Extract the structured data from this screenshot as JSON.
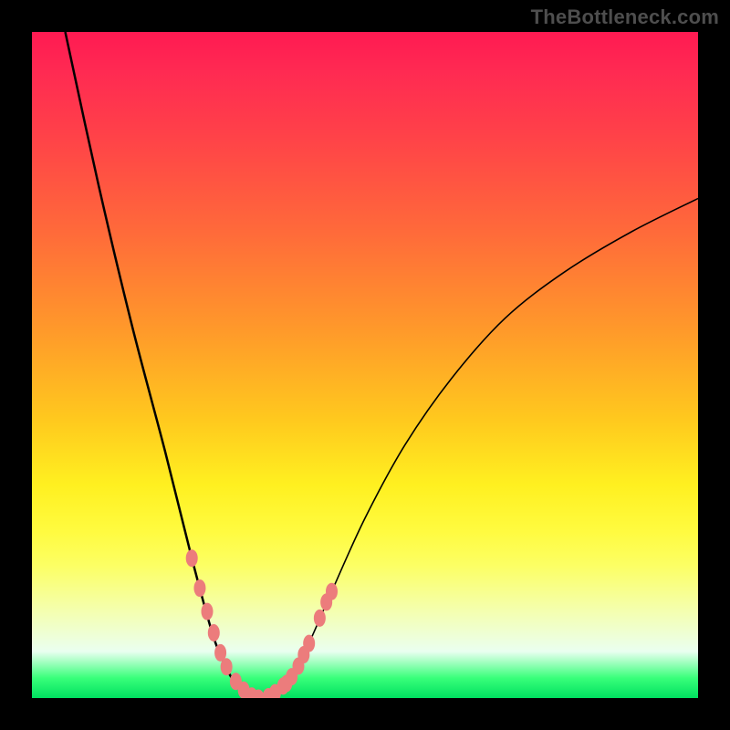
{
  "watermark": "TheBottleneck.com",
  "colors": {
    "curve": "#000000",
    "beads": "#ec7c7c"
  },
  "chart_data": {
    "type": "line",
    "title": "",
    "xlabel": "",
    "ylabel": "",
    "xlim": [
      0,
      100
    ],
    "ylim": [
      0,
      100
    ],
    "left_curve": {
      "x": [
        5,
        10,
        15,
        20,
        24,
        27,
        28.5,
        30,
        31.5,
        33,
        34
      ],
      "y": [
        100,
        77,
        56,
        37,
        21,
        10,
        6,
        3,
        1.2,
        0.3,
        0
      ]
    },
    "right_curve": {
      "x": [
        34,
        36,
        38,
        41,
        45,
        50,
        56,
        63,
        71,
        80,
        90,
        100
      ],
      "y": [
        0,
        0.5,
        2,
        7,
        16,
        27,
        38,
        48,
        57,
        64,
        70,
        75
      ]
    },
    "beads": {
      "x": [
        24,
        25.2,
        26.3,
        27.3,
        28.3,
        29.2,
        30.6,
        31.8,
        33,
        34,
        35.5,
        36.5,
        37.7,
        38.2,
        39,
        40,
        40.8,
        41.6,
        43.2,
        44.2,
        45
      ],
      "y": [
        21,
        16.5,
        13,
        9.8,
        6.8,
        4.7,
        2.5,
        1.2,
        0.3,
        0,
        0.2,
        0.8,
        1.8,
        2.2,
        3.2,
        4.8,
        6.5,
        8.2,
        12,
        14.4,
        16
      ]
    }
  }
}
